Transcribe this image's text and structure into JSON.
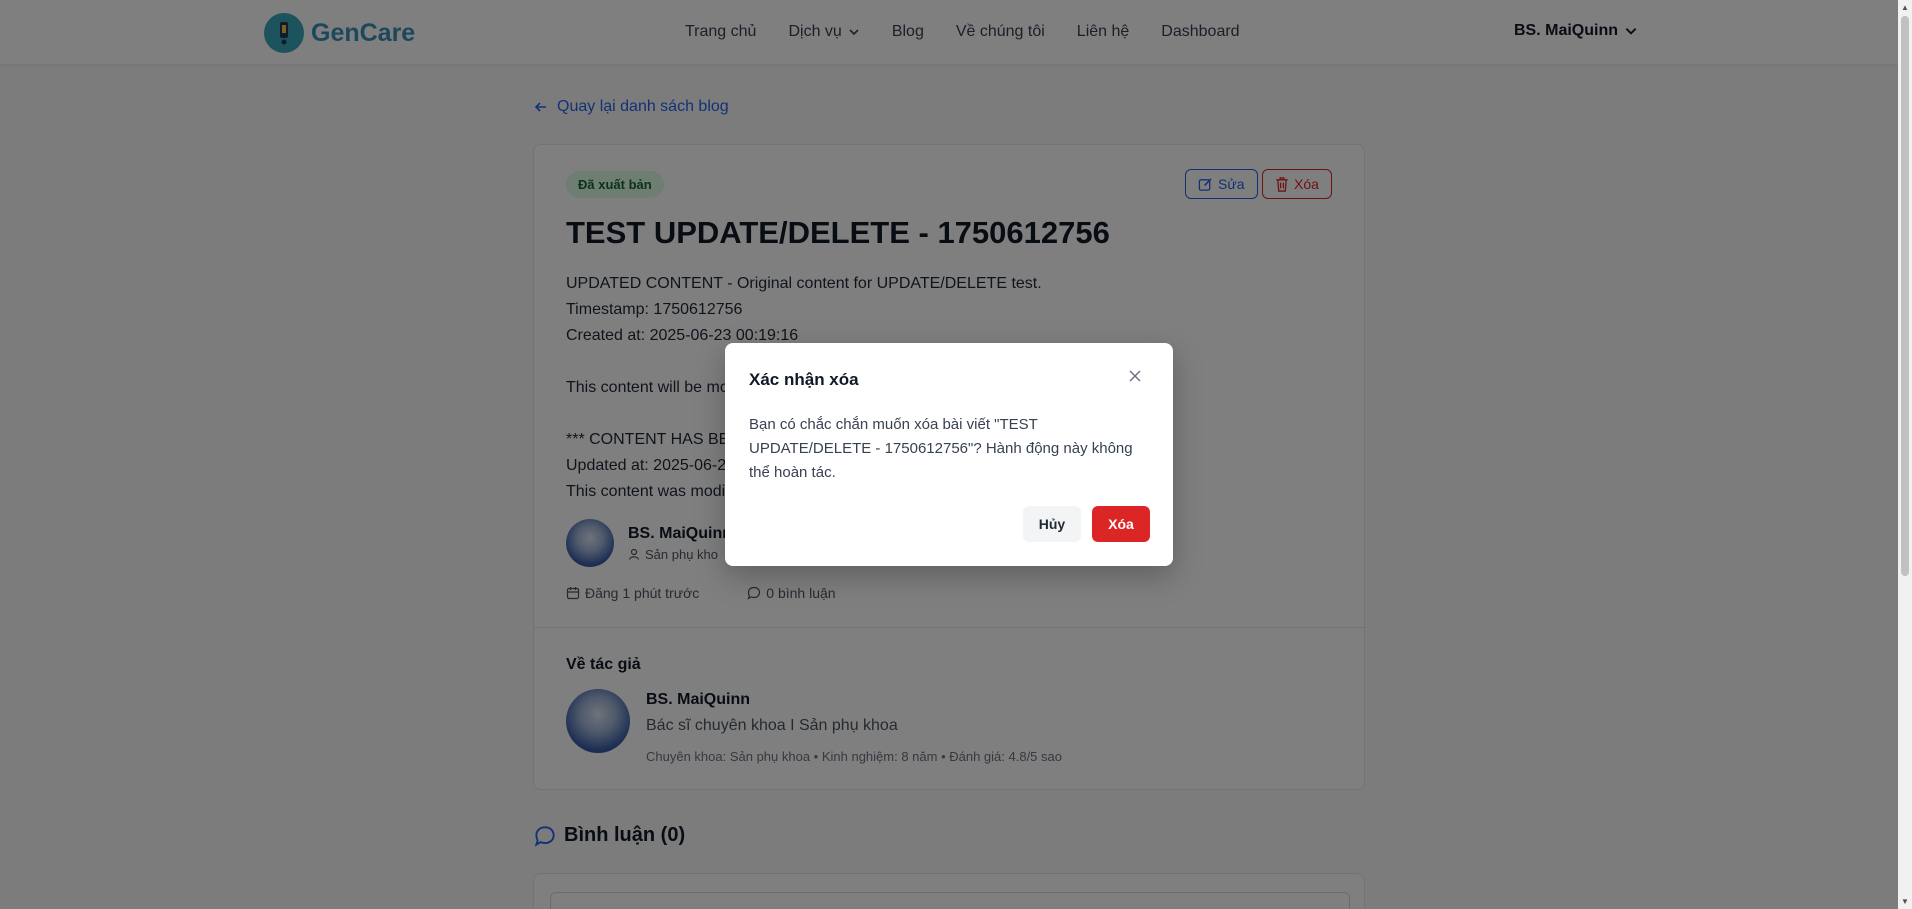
{
  "header": {
    "brand": "GenCare",
    "nav": [
      {
        "label": "Trang chủ"
      },
      {
        "label": "Dịch vụ"
      },
      {
        "label": "Blog"
      },
      {
        "label": "Về chúng tôi"
      },
      {
        "label": "Liên hệ"
      },
      {
        "label": "Dashboard"
      }
    ],
    "user": "BS. MaiQuinn"
  },
  "back_link": "Quay lại danh sách blog",
  "post": {
    "status": "Đã xuất bản",
    "edit_label": "Sửa",
    "delete_label": "Xóa",
    "title": "TEST UPDATE/DELETE - 1750612756",
    "body_lines": [
      "UPDATED CONTENT - Original content for UPDATE/DELETE test.",
      "Timestamp: 1750612756",
      "Created at: 2025-06-23 00:19:16",
      "",
      "This content will be mo",
      "",
      "*** CONTENT HAS BEE",
      "Updated at: 2025-06-2",
      "This content was modi"
    ],
    "author_name": "BS. MaiQuinn",
    "author_spec": "Sản phụ kho",
    "posted": "Đăng 1 phút trước",
    "comments_count": "0 bình luận"
  },
  "about_author": {
    "heading": "Về tác giả",
    "name": "BS. MaiQuinn",
    "title": "Bác sĩ chuyên khoa I Sản phụ khoa",
    "meta": "Chuyên khoa: Sản phụ khoa • Kinh nghiệm: 8 năm • Đánh giá: 4.8/5 sao"
  },
  "comments": {
    "heading": "Bình luận (0)"
  },
  "modal": {
    "title": "Xác nhận xóa",
    "message": "Bạn có chắc chắn muốn xóa bài viết \"TEST UPDATE/DELETE - 1750612756\"? Hành động này không thể hoàn tác.",
    "cancel_label": "Hủy",
    "confirm_label": "Xóa"
  },
  "colors": {
    "brand": "#3a8fb7",
    "primary": "#2563eb",
    "danger": "#dc2626",
    "published_bg": "#dcfce7",
    "published_text": "#166534"
  }
}
